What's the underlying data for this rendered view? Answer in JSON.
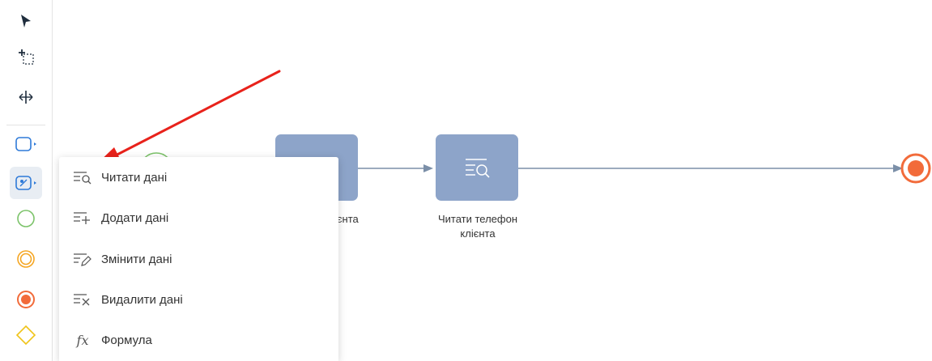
{
  "toolbar": {
    "tools": [
      {
        "icon": "pointer-icon"
      },
      {
        "icon": "lasso-select-icon"
      },
      {
        "icon": "space-tool-icon"
      },
      {
        "icon": "task-shape-icon"
      },
      {
        "icon": "data-task-icon",
        "active": true
      },
      {
        "icon": "start-event-icon"
      },
      {
        "icon": "intermediate-event-icon"
      },
      {
        "icon": "end-event-icon"
      },
      {
        "icon": "gateway-icon"
      }
    ]
  },
  "canvas": {
    "tasks": [
      {
        "label_partial": "ієнта"
      },
      {
        "label_line1": "Читати телефон",
        "label_line2": "клієнта"
      }
    ]
  },
  "menu": {
    "items": [
      {
        "icon": "read-data-icon",
        "label": "Читати дані"
      },
      {
        "icon": "add-data-icon",
        "label": "Додати дані"
      },
      {
        "icon": "edit-data-icon",
        "label": "Змінити дані"
      },
      {
        "icon": "delete-data-icon",
        "label": "Видалити дані"
      },
      {
        "icon": "formula-icon",
        "icon_glyph": "fx",
        "label": "Формула"
      }
    ]
  },
  "colors": {
    "task_fill": "#8da4c9",
    "connector": "#7b8fa8",
    "end_event": "#f26b3a",
    "start_event": "#7cc36a",
    "gateway": "#f0c419",
    "annotation_arrow": "#e8221b"
  }
}
